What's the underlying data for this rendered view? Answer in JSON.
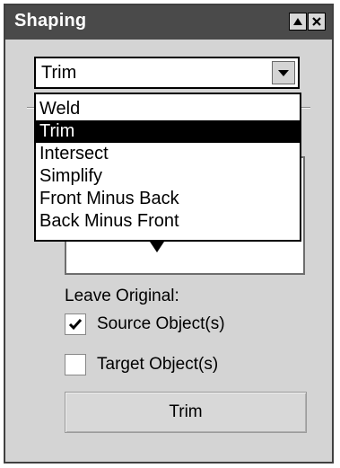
{
  "window": {
    "title": "Shaping",
    "restore_icon": "triangle-up-icon",
    "close_icon": "close-icon"
  },
  "combo": {
    "selected": "Trim",
    "arrow_icon": "chevron-down-icon"
  },
  "dropdown": {
    "options": [
      "Weld",
      "Trim",
      "Intersect",
      "Simplify",
      "Front Minus Back",
      "Back Minus Front"
    ],
    "selected_index": 1
  },
  "preview": {
    "arrow_icon": "arrow-down-icon"
  },
  "leave_original": {
    "label": "Leave Original:",
    "source": {
      "label": "Source Object(s)",
      "checked": true
    },
    "target": {
      "label": "Target Object(s)",
      "checked": false
    }
  },
  "action_button": {
    "label": "Trim"
  },
  "colors": {
    "title_bar": "#4a4a4a",
    "panel": "#d4d4d4",
    "selection": "#000000"
  }
}
